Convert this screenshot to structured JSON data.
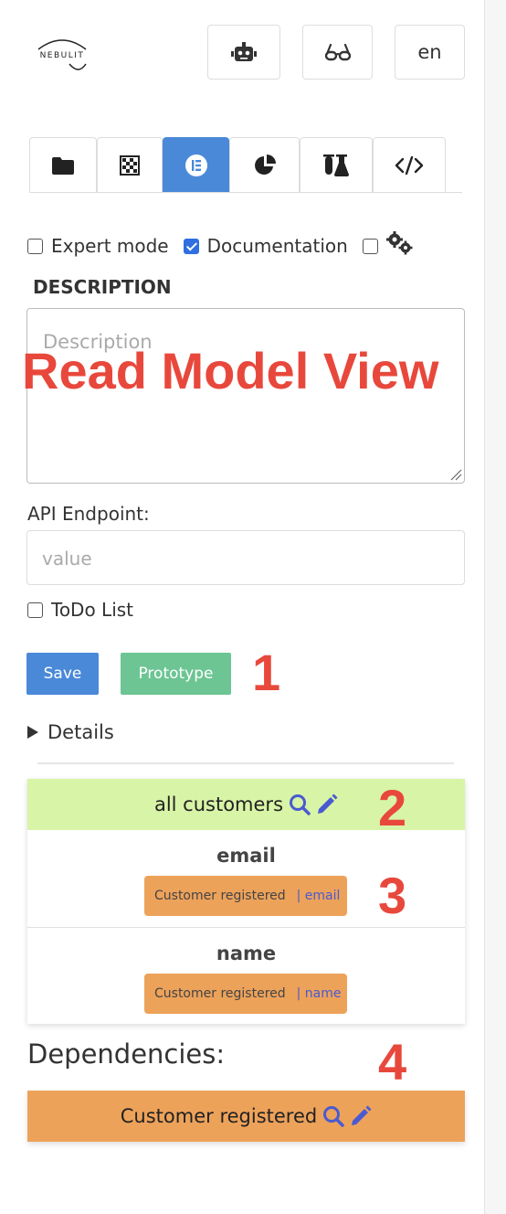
{
  "logo": {
    "text": "NEBULIT"
  },
  "top_buttons": [
    {
      "id": "assistant",
      "icon": "robot-icon"
    },
    {
      "id": "view",
      "icon": "glasses-icon"
    },
    {
      "id": "language",
      "label": "en"
    }
  ],
  "tabs": [
    {
      "icon": "folder-icon",
      "active": false
    },
    {
      "icon": "checkerboard-icon",
      "active": false
    },
    {
      "icon": "elementor-icon",
      "active": true
    },
    {
      "icon": "pie-chart-icon",
      "active": false
    },
    {
      "icon": "flask-icon",
      "active": false
    },
    {
      "icon": "code-icon",
      "active": false
    }
  ],
  "options": {
    "expert_mode": {
      "label": "Expert mode",
      "checked": false
    },
    "documentation": {
      "label": "Documentation",
      "checked": true
    },
    "settings": {
      "icon": "cogs-icon",
      "checked": false
    }
  },
  "description": {
    "heading": "DESCRIPTION",
    "placeholder": "Description",
    "value": ""
  },
  "overlay_title": "Read Model View",
  "api": {
    "label": "API Endpoint:",
    "placeholder": "value"
  },
  "todo": {
    "label": "ToDo List",
    "checked": false
  },
  "actions": {
    "save_label": "Save",
    "prototype_label": "Prototype"
  },
  "details": {
    "label": "Details"
  },
  "read_model": {
    "title": "all customers",
    "fields": [
      {
        "name": "email",
        "event": "Customer registered",
        "ref": "| email"
      },
      {
        "name": "name",
        "event": "Customer registered",
        "ref": "| name"
      }
    ]
  },
  "dependencies": {
    "title": "Dependencies:",
    "items": [
      {
        "label": "Customer registered"
      }
    ]
  },
  "annotations": [
    "1",
    "2",
    "3",
    "4"
  ],
  "colors": {
    "primary": "#4a89d8",
    "success": "#6cc593",
    "read_model": "#d8f4a6",
    "event": "#eda25a",
    "annotation": "#e8483c",
    "icon_accent": "#4a5ad0"
  }
}
